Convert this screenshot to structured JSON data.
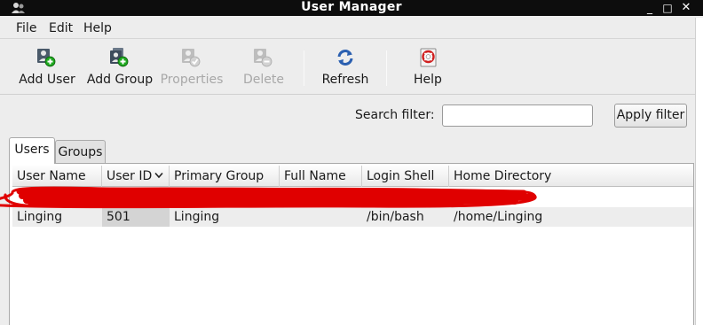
{
  "window": {
    "title": "User Manager",
    "controls": [
      "_",
      "□",
      "✕"
    ]
  },
  "menubar": {
    "file": "File",
    "edit": "Edit",
    "help": "Help"
  },
  "toolbar": {
    "add_user": "Add User",
    "add_group": "Add Group",
    "properties": "Properties",
    "delete": "Delete",
    "refresh": "Refresh",
    "help": "Help"
  },
  "search": {
    "label": "Search filter:",
    "value": "",
    "placeholder": "",
    "apply_label": "Apply filter"
  },
  "tabs": [
    {
      "label": "Users",
      "active": true
    },
    {
      "label": "Groups",
      "active": false
    }
  ],
  "table": {
    "columns": [
      "User Name",
      "User ID",
      "Primary Group",
      "Full Name",
      "Login Shell",
      "Home Directory"
    ],
    "sorted_column": "User ID",
    "rows": [
      {
        "user_name": "",
        "user_id": "",
        "primary_group": "",
        "full_name": "",
        "login_shell": "",
        "home_directory": "",
        "redacted": true
      },
      {
        "user_name": "Linging",
        "user_id": "501",
        "primary_group": "Linging",
        "full_name": "",
        "login_shell": "/bin/bash",
        "home_directory": "/home/Linging"
      }
    ]
  },
  "colors": {
    "titlebar": "#0d0d0d",
    "window_bg": "#ededed",
    "redaction": "#e00000",
    "add_badge": "#1ea81e"
  },
  "icons": {
    "app": "user-manager-icon",
    "add_user": "add-user-icon",
    "add_group": "add-group-icon",
    "properties": "properties-icon",
    "delete": "delete-user-icon",
    "refresh": "refresh-icon",
    "help": "help-lifebuoy-icon",
    "sort": "chevron-down-icon"
  }
}
